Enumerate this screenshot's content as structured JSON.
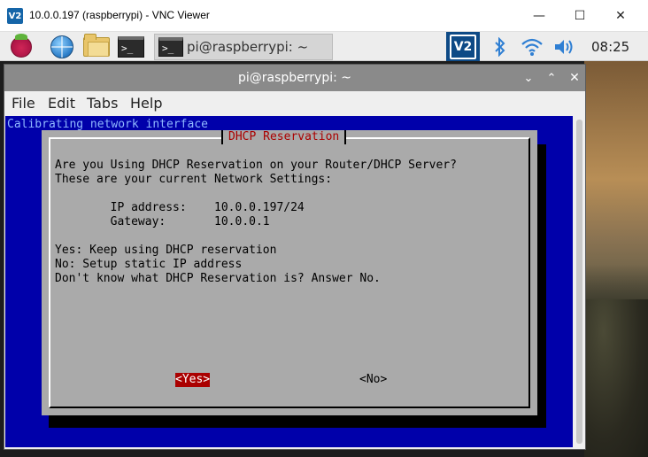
{
  "vnc_window": {
    "title": "10.0.0.197 (raspberrypi) - VNC Viewer",
    "logo_text": "V2",
    "controls": {
      "minimize": "—",
      "maximize": "☐",
      "close": "✕"
    }
  },
  "pi_panel": {
    "taskbar_item_label": "pi@raspberrypi: ~",
    "terminal_glyph": ">_",
    "tray_vnc_text": "V2",
    "time": "08:25",
    "icons": [
      "raspberry-menu-icon",
      "web-browser-icon",
      "file-manager-icon",
      "terminal-icon",
      "vnc-server-icon",
      "bluetooth-icon",
      "wifi-icon",
      "volume-icon"
    ]
  },
  "terminal_window": {
    "title": "pi@raspberrypi: ~",
    "controls": {
      "minimize": "⌄",
      "maximize": "⌃",
      "close": "✕"
    },
    "menu": [
      "File",
      "Edit",
      "Tabs",
      "Help"
    ],
    "backtitle": "Calibrating network interface",
    "colors": {
      "background": "#0000aa",
      "dialog": "#aaaaaa",
      "title_text": "#aa0000",
      "selected_button": "#aa0000"
    }
  },
  "dialog": {
    "title": "DHCP Reservation",
    "lines": [
      "Are you Using DHCP Reservation on your Router/DHCP Server?",
      "These are your current Network Settings:",
      "",
      "        IP address:    10.0.0.197/24",
      "        Gateway:       10.0.0.1",
      "",
      "Yes: Keep using DHCP reservation",
      "No: Setup static IP address",
      "Don't know what DHCP Reservation is? Answer No."
    ],
    "buttons": {
      "yes": "<Yes>",
      "no": "<No>"
    },
    "selected_button": "yes"
  }
}
